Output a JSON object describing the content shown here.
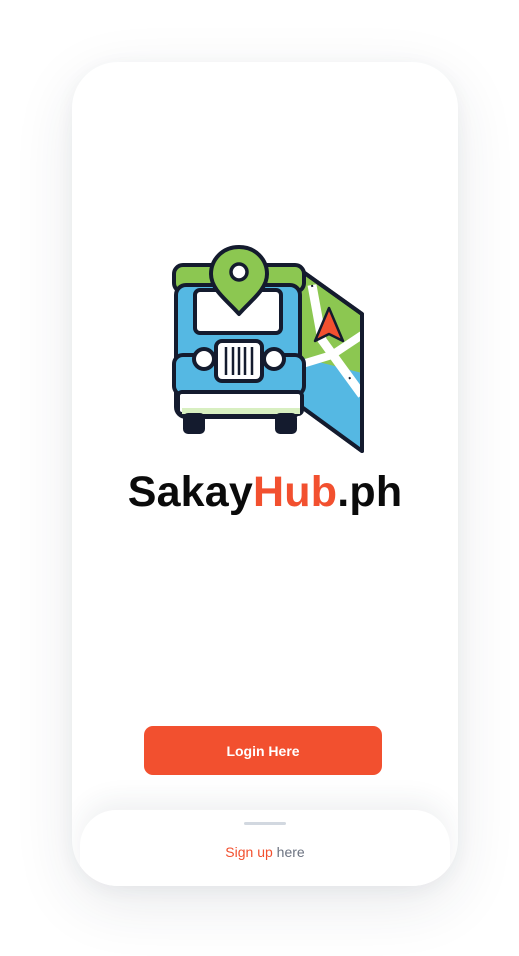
{
  "brand": {
    "name_part1": "Sakay",
    "name_part2": "Hub",
    "name_part3": ".ph",
    "logo_icon": "jeepney-map-pin-icon",
    "accent_color": "#f2502f",
    "text_color": "#0b0b0b"
  },
  "actions": {
    "login_label": "Login Here"
  },
  "bottom_sheet": {
    "signup_link": "Sign up",
    "signup_suffix": " here"
  }
}
